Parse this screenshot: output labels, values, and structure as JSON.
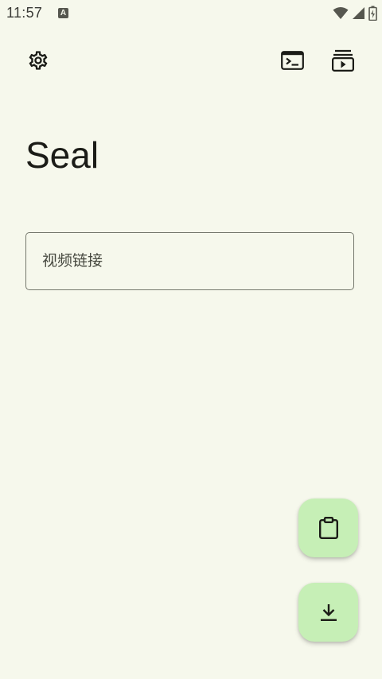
{
  "status_bar": {
    "time": "11:57",
    "notification_letter": "A",
    "icons": [
      "wifi-icon",
      "cellular-signal-icon",
      "battery-icon"
    ]
  },
  "toolbar": {
    "settings_icon": "settings-gear-icon",
    "terminal_icon": "terminal-icon",
    "queue_icon": "download-queue-icon"
  },
  "app": {
    "title": "Seal"
  },
  "url_input": {
    "value": "",
    "placeholder": "视频链接"
  },
  "fabs": {
    "paste_icon": "clipboard-icon",
    "download_icon": "download-icon"
  },
  "colors": {
    "background": "#f6f8ec",
    "fab_container": "#c6efb6",
    "on_surface": "#1b1c17",
    "outline": "#75786d"
  }
}
